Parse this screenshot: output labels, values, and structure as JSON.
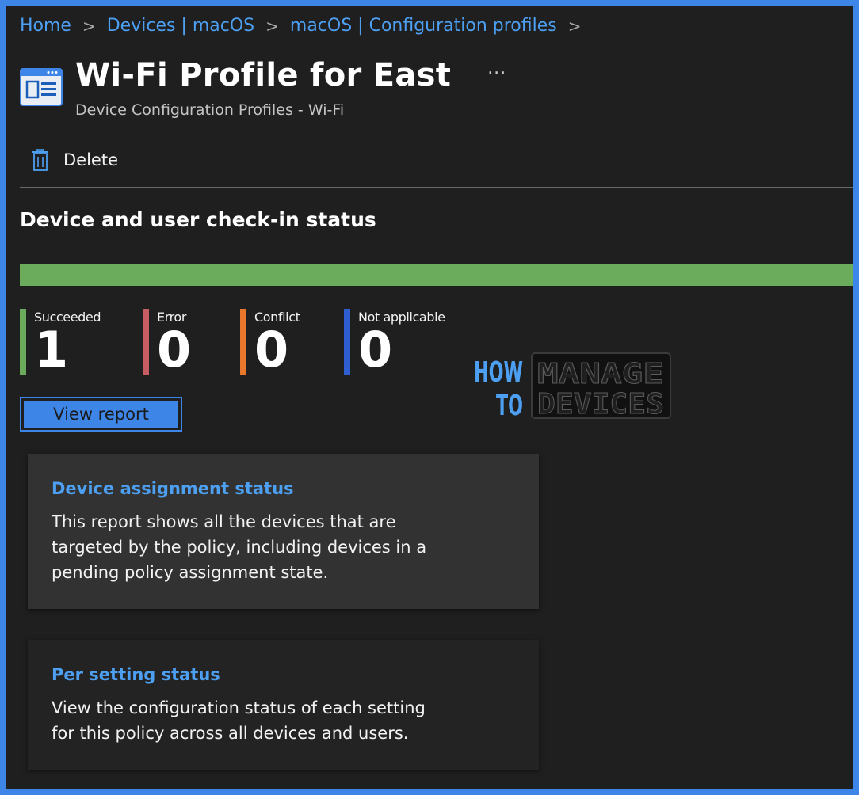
{
  "breadcrumb": {
    "items": [
      "Home",
      "Devices | macOS",
      "macOS | Configuration profiles"
    ],
    "separator": ">"
  },
  "header": {
    "title": "Wi-Fi Profile for East",
    "subtitle": "Device Configuration Profiles - Wi-Fi",
    "more_label": "..."
  },
  "toolbar": {
    "delete_label": "Delete",
    "delete_icon": "trash-icon"
  },
  "checkin": {
    "title": "Device and user check-in status",
    "progress": {
      "succeeded_fraction": 1.0,
      "color": "#6aac5c"
    },
    "stats": [
      {
        "label": "Succeeded",
        "value": "1",
        "color": "#6aac5c"
      },
      {
        "label": "Error",
        "value": "0",
        "color": "#c75c62"
      },
      {
        "label": "Conflict",
        "value": "0",
        "color": "#e8772e"
      },
      {
        "label": "Not applicable",
        "value": "0",
        "color": "#2f5ed0"
      }
    ],
    "view_report_label": "View report"
  },
  "watermark": {
    "line1": "HOW",
    "line2": "TO",
    "brand1": "MANAGE",
    "brand2": "DEVICES"
  },
  "cards": [
    {
      "title": "Device assignment status",
      "description": "This report shows all the devices that are targeted by the policy, including devices in a pending policy assignment state."
    },
    {
      "title": "Per setting status",
      "description": "View the configuration status of each setting for this policy across all devices and users."
    }
  ],
  "colors": {
    "accent": "#4d9ff2",
    "frame_border": "#3d86e8",
    "background": "#1f1f1f"
  }
}
